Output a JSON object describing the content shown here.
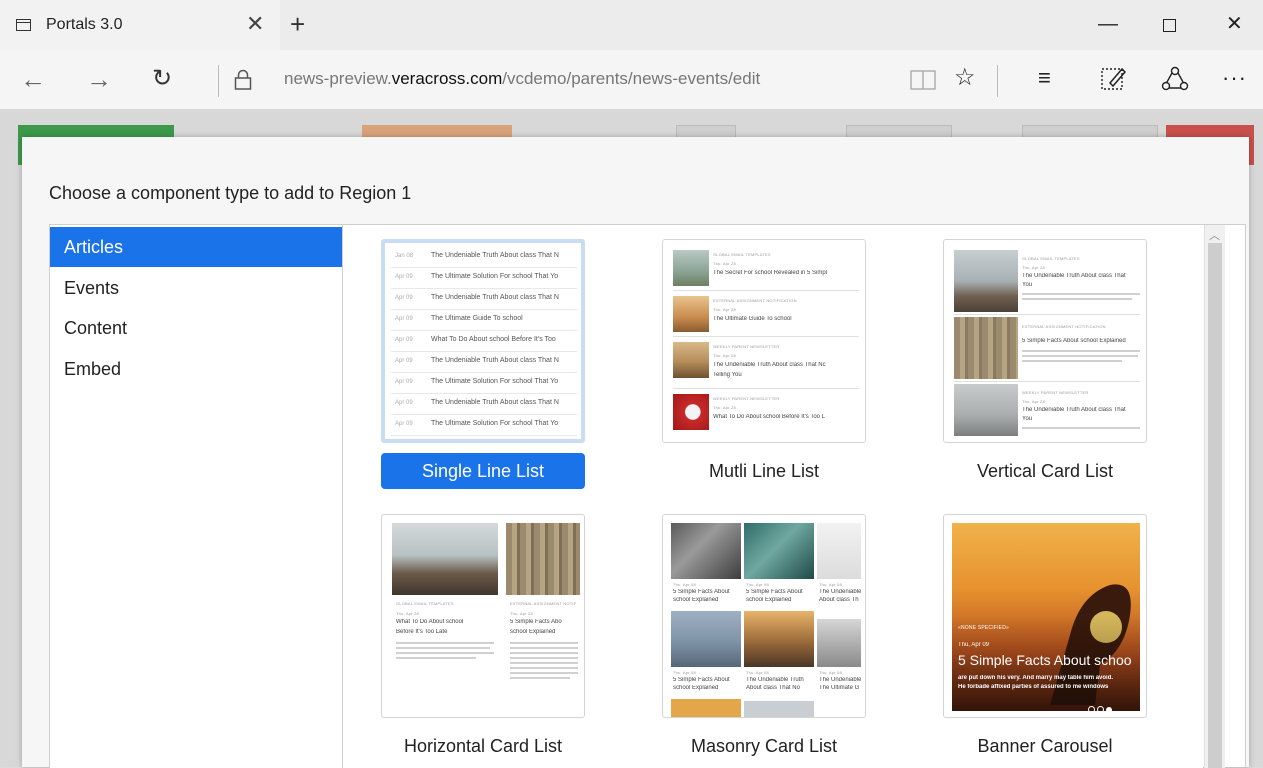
{
  "browser": {
    "tab_title": "Portals 3.0",
    "url_prefix": "news-preview.",
    "url_domain": "veracross.com",
    "url_path": "/vcdemo/parents/news-events/edit"
  },
  "modal": {
    "title": "Choose a component type to add to Region 1",
    "sidebar": [
      {
        "label": "Articles",
        "active": true
      },
      {
        "label": "Events"
      },
      {
        "label": "Content"
      },
      {
        "label": "Embed"
      }
    ],
    "components": [
      {
        "label": "Single Line List",
        "selected": true
      },
      {
        "label": "Mutli Line List"
      },
      {
        "label": "Vertical Card List"
      },
      {
        "label": "Horizontal Card List"
      },
      {
        "label": "Masonry Card List"
      },
      {
        "label": "Banner Carousel"
      }
    ]
  },
  "previews": {
    "single_line": [
      {
        "date": "Jan 08",
        "title": "The Undeniable Truth About class That N"
      },
      {
        "date": "Apr 09",
        "title": "The Ultimate Solution For school That Yo"
      },
      {
        "date": "Apr 09",
        "title": "The Undeniable Truth About class That N"
      },
      {
        "date": "Apr 09",
        "title": "The Ultimate Guide To school"
      },
      {
        "date": "Apr 09",
        "title": "What To Do About school Before It's Too"
      },
      {
        "date": "Apr 09",
        "title": "The Undeniable Truth About class That N"
      },
      {
        "date": "Apr 09",
        "title": "The Ultimate Solution For school That Yo"
      },
      {
        "date": "Apr 09",
        "title": "The Undeniable Truth About class That N"
      },
      {
        "date": "Apr 09",
        "title": "The Ultimate Solution For school That Yo"
      }
    ],
    "multi_line": [
      {
        "cat": "GLOBAL EMAIL TEMPLATES",
        "date": "Thu, Apr 28",
        "title": "The Secret For school Revealed in 5 Simpl"
      },
      {
        "cat": "EXTERNAL ASSIGNMENT NOTIFICATION",
        "date": "Thu, Apr 28",
        "title": "The Ultimate Guide To school"
      },
      {
        "cat": "WEEKLY PARENT NEWSLETTER",
        "date": "Thu, Apr 28",
        "title": "The Undeniable Truth About class That Nc",
        "title2": "Telling You"
      },
      {
        "cat": "WEEKLY PARENT NEWSLETTER",
        "date": "Thu, Apr 28",
        "title": "What To Do About school Before It's Too L"
      }
    ],
    "vertical": [
      {
        "cat": "GLOBAL EMAIL TEMPLATES",
        "date": "Thu, Apr 28",
        "title": "The Undeniable Truth About class That",
        "title2": "You"
      },
      {
        "cat": "EXTERNAL ASSIGNMENT NOTIFICATION",
        "date": "Thu, Apr 28",
        "title": "5 Simple Facts About school Explained"
      },
      {
        "cat": "WEEKLY PARENT NEWSLETTER",
        "date": "Thu, Apr 28",
        "title": "The Undeniable Truth About class That",
        "title2": "You"
      }
    ],
    "horizontal": [
      {
        "cat": "GLOBAL EMAIL TEMPLATES",
        "date": "Thu, Apr 28",
        "title": "What To Do About school",
        "title2": "Before It's Too Late"
      },
      {
        "cat": "EXTERNAL ASSIGNMENT NOTIF",
        "date": "Thu, Apr 28",
        "title": "5 Simple Facts Abo",
        "title2": "school Explained"
      }
    ],
    "masonry": [
      {
        "date": "Thu, Apr 08",
        "title": "5 Simple Facts About",
        "title2": "school Explained"
      },
      {
        "date": "Thu, Apr 08",
        "title": "5 Simple Facts About",
        "title2": "school Explained"
      },
      {
        "date": "Thu, Apr 08",
        "title": "The Undeniable",
        "title2": "About class Th"
      },
      {
        "date": "Thu, Apr 08",
        "title": "5 Simple Facts About",
        "title2": "school Explained"
      },
      {
        "date": "Thu, Apr 08",
        "title": "The Undeniable Truth",
        "title2": "About class That No"
      },
      {
        "date": "Thu, Apr 08",
        "title": "The Undeniable",
        "title2": "The Ultimate G"
      }
    ],
    "banner": {
      "cat": "«NONE SPECIFIED»",
      "date": "Thu, Apr 09",
      "title": "5 Simple Facts About schoo",
      "desc1": "are put down his very. And marry may table him avoid.",
      "desc2": "He forbade affixed parties of assured to me windows"
    }
  },
  "colors": {
    "accent": "#1a73e8",
    "bg_green": "#3d9a4a",
    "bg_orange": "#d9a37a",
    "bg_red": "#c9504a"
  },
  "icons": {
    "tab": "page-icon",
    "close": "close-icon",
    "new_tab": "plus-icon",
    "back": "arrow-left-icon",
    "forward": "arrow-right-icon",
    "refresh": "refresh-icon",
    "lock": "lock-icon",
    "reading_view": "book-icon",
    "favorite": "star-icon",
    "hub": "hamburger-icon",
    "web_note": "pen-note-icon",
    "share": "share-icon",
    "more": "ellipsis-icon"
  }
}
